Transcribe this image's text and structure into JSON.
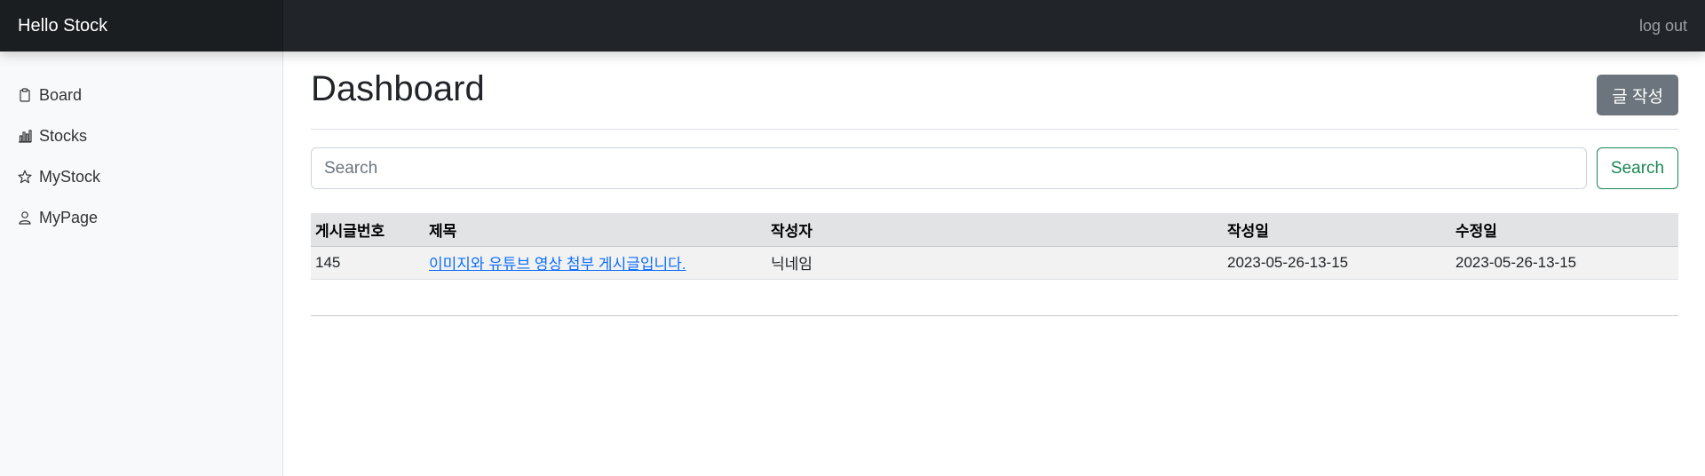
{
  "header": {
    "brand": "Hello Stock",
    "logout_label": "log out"
  },
  "sidebar": {
    "items": [
      {
        "label": "Board",
        "icon": "clipboard-icon"
      },
      {
        "label": "Stocks",
        "icon": "bar-chart-icon"
      },
      {
        "label": "MyStock",
        "icon": "star-icon"
      },
      {
        "label": "MyPage",
        "icon": "person-icon"
      }
    ]
  },
  "main": {
    "title": "Dashboard",
    "write_button_label": "글 작성",
    "search": {
      "placeholder": "Search",
      "value": "",
      "button_label": "Search"
    },
    "table": {
      "columns": [
        "게시글번호",
        "제목",
        "작성자",
        "작성일",
        "수정일"
      ],
      "rows": [
        {
          "id": "145",
          "title": "이미지와 유튜브 영상 첨부 게시글입니다.",
          "author": "닉네임",
          "created": "2023-05-26-13-15",
          "updated": "2023-05-26-13-15"
        }
      ]
    }
  },
  "colors": {
    "topbar": "#212529",
    "secondary_button": "#6c757d",
    "success_outline": "#198754",
    "link": "#0d6efd"
  }
}
